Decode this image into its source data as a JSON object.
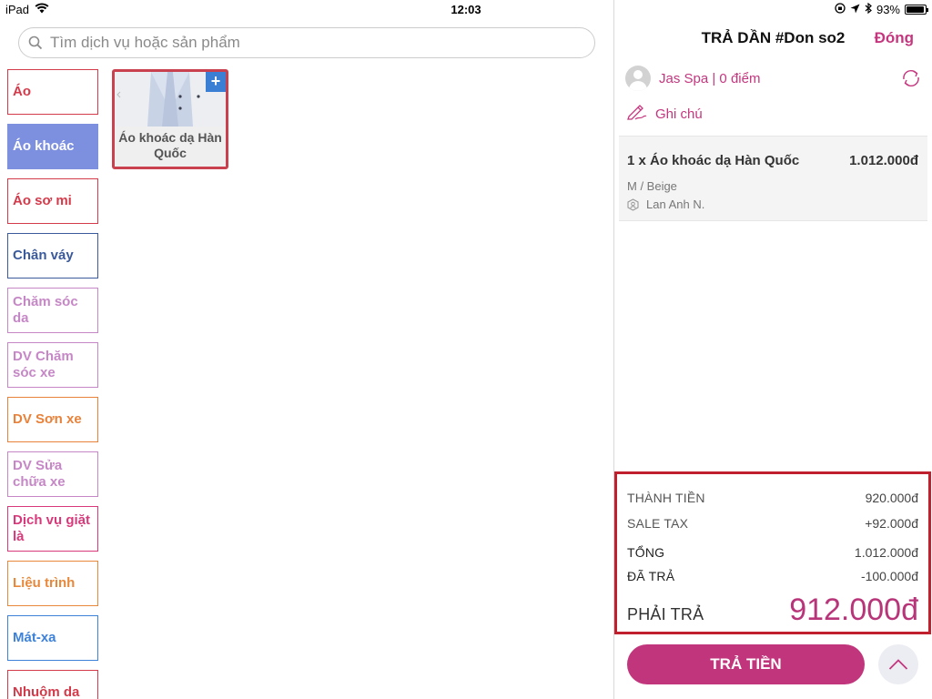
{
  "status_bar": {
    "device": "iPad",
    "time": "12:03",
    "battery": "93%",
    "battery_level": 0.93
  },
  "search": {
    "placeholder": "Tìm dịch vụ hoặc sản phẩm"
  },
  "categories": [
    {
      "label": "Áo",
      "color": "#d33a4a",
      "active": false
    },
    {
      "label": "Áo khoác",
      "color": "#7d8fdf",
      "active": true
    },
    {
      "label": "Áo sơ mi",
      "color": "#d33a4a",
      "active": false
    },
    {
      "label": "Chân váy",
      "color": "#3a5a9c",
      "active": false
    },
    {
      "label": "Chăm sóc da",
      "color": "#c687c6",
      "active": false
    },
    {
      "label": "DV Chăm sóc xe",
      "color": "#c687c6",
      "active": false
    },
    {
      "label": "DV Sơn xe",
      "color": "#e8823a",
      "active": false
    },
    {
      "label": "DV Sửa chữa xe",
      "color": "#c687c6",
      "active": false
    },
    {
      "label": "Dịch vụ giặt là",
      "color": "#d8397a",
      "active": false
    },
    {
      "label": "Liệu trình",
      "color": "#e8883a",
      "active": false
    },
    {
      "label": "Mát-xa",
      "color": "#3d82d8",
      "active": false
    },
    {
      "label": "Nhuộm da",
      "color": "#d33a4a",
      "active": false
    }
  ],
  "products": [
    {
      "name": "Áo khoác dạ Hàn Quốc",
      "add_label": "+"
    }
  ],
  "order": {
    "title": "TRẢ DẦN #Don so2",
    "close_label": "Đóng",
    "customer": "Jas Spa | 0 điểm",
    "note_label": "Ghi chú",
    "items": [
      {
        "title": "1 x Áo khoác dạ Hàn Quốc",
        "price": "1.012.000đ",
        "variant": "M / Beige",
        "staff": "Lan Anh N."
      }
    ]
  },
  "totals": {
    "subtotal_label": "THÀNH TIỀN",
    "subtotal_value": "920.000đ",
    "tax_label": "SALE TAX",
    "tax_value": "+92.000đ",
    "total_label": "TỔNG",
    "total_value": "1.012.000đ",
    "paid_label": "ĐÃ TRẢ",
    "paid_value": "-100.000đ",
    "due_label": "PHẢI TRẢ",
    "due_value": "912.000đ"
  },
  "actions": {
    "pay_label": "TRẢ TIỀN"
  },
  "colors": {
    "brand": "#c0357c",
    "highlight_border": "#c0202e"
  }
}
